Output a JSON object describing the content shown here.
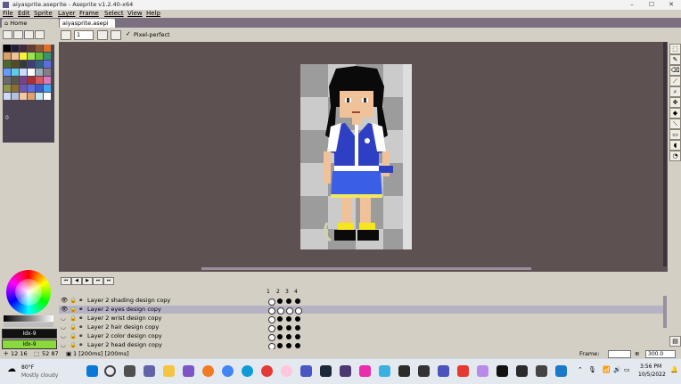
{
  "window": {
    "title": "aiyasprite.aseprite - Aseprite v1.2.40-x64",
    "controls": [
      "–",
      "☐",
      "✕"
    ]
  },
  "menu": [
    "File",
    "Edit",
    "Sprite",
    "Layer",
    "Frame",
    "Select",
    "View",
    "Help"
  ],
  "tabs": [
    {
      "label": "Home"
    },
    {
      "label": "aiyasprite.asepi ✕"
    }
  ],
  "context_bar": {
    "brush_size": "1",
    "pixel_perfect_label": "Pixel-perfect"
  },
  "palette": {
    "index_label": "0",
    "colors": [
      "#000000",
      "#222034",
      "#45283c",
      "#663931",
      "#8f563b",
      "#df7126",
      "#d9a066",
      "#eec39a",
      "#fbf236",
      "#99e550",
      "#6abe30",
      "#37946e",
      "#4b692f",
      "#524b24",
      "#323c39",
      "#3f3f74",
      "#306082",
      "#5b6ee1",
      "#639bff",
      "#5fcde4",
      "#cbdbfc",
      "#ffffff",
      "#9badb7",
      "#847e87",
      "#696a6a",
      "#595652",
      "#76428a",
      "#ac3232",
      "#d95763",
      "#d77bba",
      "#8f974a",
      "#8a6f30",
      "#6b57b8",
      "#5b6ee1",
      "#3b5dc9",
      "#41a6f6",
      "#cbdbfc",
      "#b6c0d8",
      "#f4c7a0",
      "#e0a070",
      "#c7e8f3",
      "#ffffff"
    ]
  },
  "color_bars": {
    "foreground": "Idx-9",
    "background": "Idx-9"
  },
  "timeline": {
    "frame_numbers": [
      "1",
      "2",
      "3",
      "4"
    ],
    "layers": [
      {
        "name": "Layer 2 shading design copy",
        "selected": false
      },
      {
        "name": "Layer 2 eyes design copy",
        "selected": true
      },
      {
        "name": "Layer 2 wrist design copy",
        "selected": false
      },
      {
        "name": "Layer 2 hair design copy",
        "selected": false
      },
      {
        "name": "Layer 2 color design copy",
        "selected": false
      },
      {
        "name": "Layer 2 head design copy",
        "selected": false
      }
    ],
    "frame_label": "Frame:",
    "zoom_value": "300.0"
  },
  "status": {
    "coords": "12 16",
    "size": "52 87",
    "frame_info": "1 [200ms] [200ms]"
  },
  "taskbar": {
    "weather_temp": "80°F",
    "weather_desc": "Mostly cloudy",
    "time": "3:56 PM",
    "date": "10/5/2022"
  }
}
